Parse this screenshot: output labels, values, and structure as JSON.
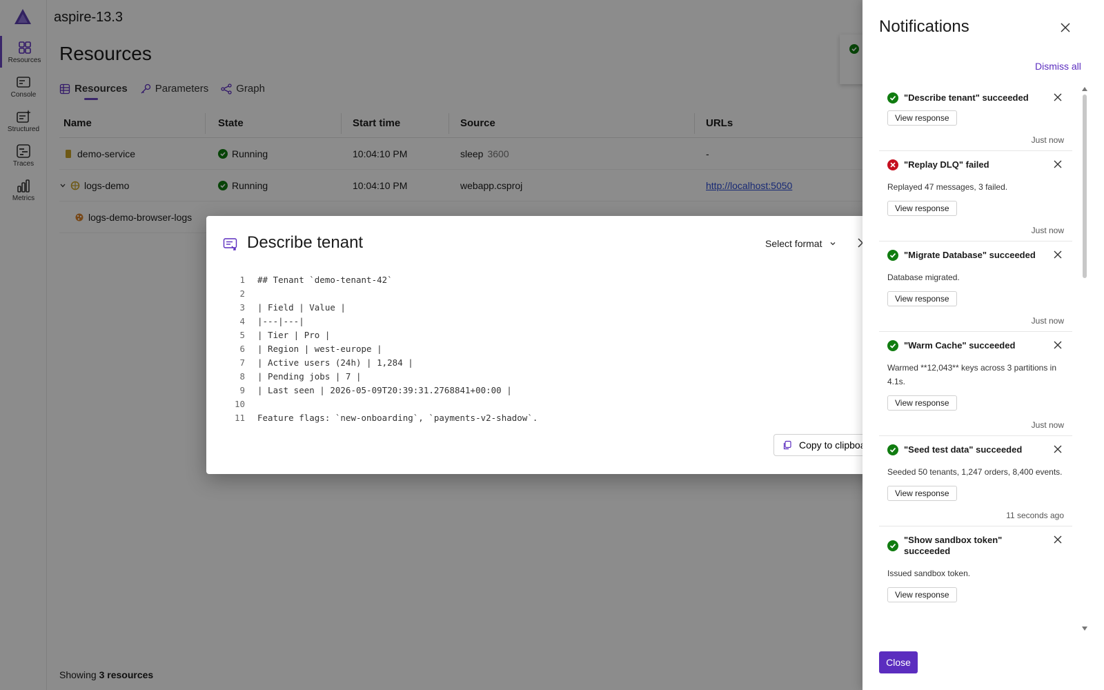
{
  "app": {
    "title": "aspire-13.3"
  },
  "nav": {
    "items": [
      {
        "label": "Resources",
        "icon": "resources-icon",
        "active": true
      },
      {
        "label": "Console",
        "icon": "console-icon"
      },
      {
        "label": "Structured",
        "icon": "structured-logs-icon"
      },
      {
        "label": "Traces",
        "icon": "traces-icon"
      },
      {
        "label": "Metrics",
        "icon": "metrics-icon"
      }
    ]
  },
  "page": {
    "title": "Resources",
    "tabs": [
      {
        "label": "Resources",
        "active": true
      },
      {
        "label": "Parameters"
      },
      {
        "label": "Graph"
      }
    ],
    "columns": [
      "Name",
      "State",
      "Start time",
      "Source",
      "URLs"
    ],
    "rows": [
      {
        "name": "demo-service",
        "state": "Running",
        "start": "10:04:10 PM",
        "source": "sleep",
        "source_arg": "3600",
        "url": "-"
      },
      {
        "name": "logs-demo",
        "state": "Running",
        "start": "10:04:10 PM",
        "source": "webapp.csproj",
        "source_arg": "",
        "url": "http://localhost:5050"
      },
      {
        "name": "logs-demo-browser-logs",
        "state": "",
        "start": "",
        "source": "",
        "source_arg": "",
        "url": ""
      }
    ],
    "footer_prefix": "Showing",
    "footer_count": "3 resources"
  },
  "dialog": {
    "title": "Describe tenant",
    "format_label": "Select format",
    "copy_label": "Copy to clipboard",
    "lines": [
      {
        "n": "1",
        "text": "## Tenant `demo-tenant-42`"
      },
      {
        "n": "2",
        "text": ""
      },
      {
        "n": "3",
        "text": "| Field | Value |"
      },
      {
        "n": "4",
        "text": "|---|---|"
      },
      {
        "n": "5",
        "text": "| Tier | Pro |"
      },
      {
        "n": "6",
        "text": "| Region | west-europe |"
      },
      {
        "n": "7",
        "text": "| Active users (24h) | 1,284 |"
      },
      {
        "n": "8",
        "text": "| Pending jobs | 7 |"
      },
      {
        "n": "9",
        "text": "| Last seen | 2026-05-09T20:39:31.2768841+00:00 |"
      },
      {
        "n": "10",
        "text": ""
      },
      {
        "n": "11",
        "text": "Feature flags: `new-onboarding`, `payments-v2-shadow`."
      }
    ]
  },
  "notifications": {
    "title": "Notifications",
    "dismiss_all": "Dismiss all",
    "close_label": "Close",
    "view_label": "View response",
    "items": [
      {
        "status": "success",
        "title": "\"Describe tenant\" succeeded",
        "body": "",
        "time": "Just now"
      },
      {
        "status": "error",
        "title": "\"Replay DLQ\" failed",
        "body": "Replayed 47 messages, 3 failed.",
        "time": "Just now"
      },
      {
        "status": "success",
        "title": "\"Migrate Database\" succeeded",
        "body": "Database migrated.",
        "time": "Just now"
      },
      {
        "status": "success",
        "title": "\"Warm Cache\" succeeded",
        "body": "Warmed **12,043** keys across 3 partitions in 4.1s.",
        "time": "Just now"
      },
      {
        "status": "success",
        "title": "\"Seed test data\" succeeded",
        "body": "Seeded 50 tenants, 1,247 orders, 8,400 events.",
        "time": "11 seconds ago"
      },
      {
        "status": "success",
        "title": "\"Show sandbox token\" succeeded",
        "body": "Issued sandbox token.",
        "time": ""
      }
    ]
  },
  "colors": {
    "accent": "#5b2dbf",
    "success": "#107c10",
    "error": "#c50f1f",
    "link": "#2b4bd4"
  }
}
